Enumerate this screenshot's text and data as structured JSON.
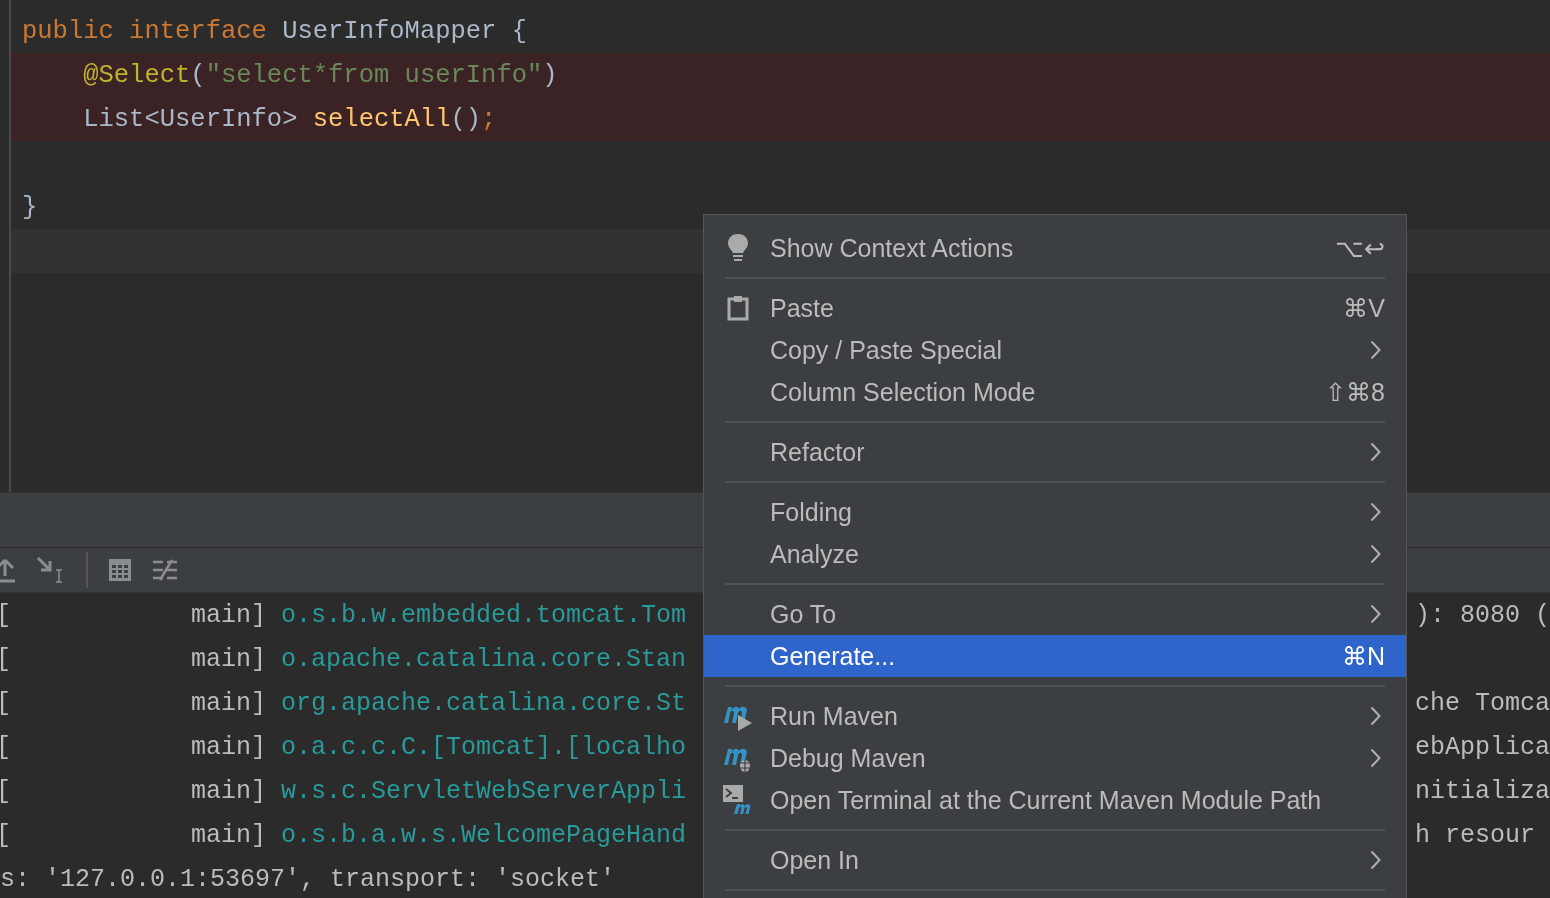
{
  "editor": {
    "lines": [
      {
        "kind": "normal",
        "tokens": [
          {
            "kind": "keyword",
            "text": "public interface "
          },
          {
            "kind": "plain",
            "text": "UserInfoMapper {"
          }
        ]
      },
      {
        "kind": "error",
        "tokens": [
          {
            "kind": "annotation",
            "text": "    @Select"
          },
          {
            "kind": "plain",
            "text": "("
          },
          {
            "kind": "string",
            "text": "\"select*from userInfo\""
          },
          {
            "kind": "plain",
            "text": ")"
          }
        ]
      },
      {
        "kind": "error",
        "tokens": [
          {
            "kind": "plain",
            "text": "    List<UserInfo> "
          },
          {
            "kind": "method",
            "text": "selectAll"
          },
          {
            "kind": "plain",
            "text": "()"
          },
          {
            "kind": "keyword",
            "text": ";"
          }
        ]
      },
      {
        "kind": "blank"
      },
      {
        "kind": "normal",
        "tokens": [
          {
            "kind": "plain",
            "text": "}"
          }
        ]
      },
      {
        "kind": "current"
      }
    ]
  },
  "console": {
    "rows": [
      {
        "kind": "log",
        "prefix": "[            main]",
        "logger": "o.s.b.w.embedded.tomcat.Tom",
        "tail": "): 8080 ("
      },
      {
        "kind": "log",
        "prefix": "[            main]",
        "logger": "o.apache.catalina.core.Stan"
      },
      {
        "kind": "log",
        "prefix": "[            main]",
        "logger": "org.apache.catalina.core.St",
        "tail": "che Tomca"
      },
      {
        "kind": "log",
        "prefix": "[            main]",
        "logger": "o.a.c.c.C.[Tomcat].[localho",
        "tail": "ebApplica"
      },
      {
        "kind": "log",
        "prefix": "[            main]",
        "logger": "w.s.c.ServletWebServerAppli",
        "tail": "nitializa"
      },
      {
        "kind": "log",
        "prefix": "[            main]",
        "logger": "o.s.b.a.w.s.WelcomePageHand",
        "tail": "h resour"
      },
      {
        "kind": "plain",
        "text": "s: '127.0.0.1:53697', transport: 'socket'"
      }
    ]
  },
  "context_menu": {
    "groups": [
      [
        {
          "label": "Show Context Actions",
          "shortcut": "⌥↩",
          "submenu": false,
          "selected": false
        }
      ],
      [
        {
          "label": "Paste",
          "shortcut": "⌘V",
          "submenu": false,
          "selected": false
        },
        {
          "label": "Copy / Paste Special",
          "submenu": true,
          "selected": false
        },
        {
          "label": "Column Selection Mode",
          "shortcut": "⇧⌘8",
          "submenu": false,
          "selected": false
        }
      ],
      [
        {
          "label": "Refactor",
          "submenu": true,
          "selected": false
        }
      ],
      [
        {
          "label": "Folding",
          "submenu": true,
          "selected": false
        },
        {
          "label": "Analyze",
          "submenu": true,
          "selected": false
        }
      ],
      [
        {
          "label": "Go To",
          "submenu": true,
          "selected": false
        },
        {
          "label": "Generate...",
          "shortcut": "⌘N",
          "submenu": false,
          "selected": true
        }
      ],
      [
        {
          "label": "Run Maven",
          "submenu": true,
          "selected": false
        },
        {
          "label": "Debug Maven",
          "submenu": true,
          "selected": false
        },
        {
          "label": "Open Terminal at the Current Maven Module Path",
          "submenu": false,
          "selected": false
        }
      ],
      [
        {
          "label": "Open In",
          "submenu": true,
          "selected": false
        }
      ]
    ]
  }
}
